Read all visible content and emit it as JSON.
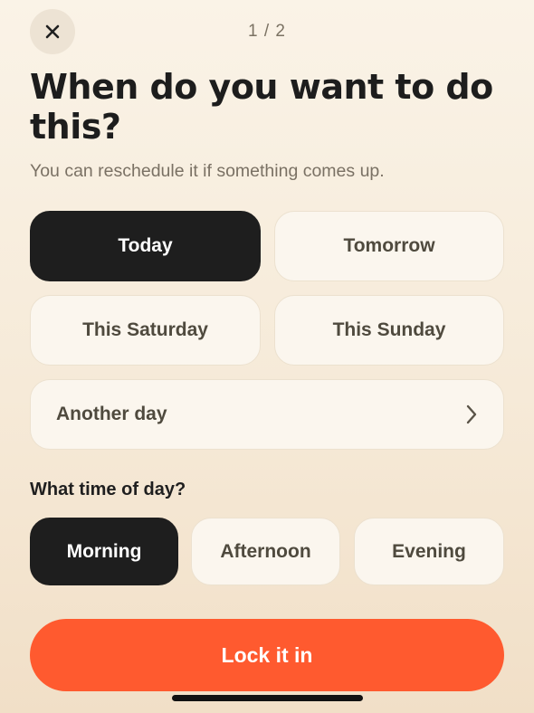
{
  "header": {
    "step": "1 / 2",
    "close_icon": "close-icon"
  },
  "title": "When do you want to do this?",
  "subtitle": "You can reschedule it if something comes up.",
  "day_options": {
    "today": "Today",
    "tomorrow": "Tomorrow",
    "saturday": "This Saturday",
    "sunday": "This Sunday",
    "another_day": "Another day",
    "another_day_icon": "chevron-right-icon",
    "selected": "Today"
  },
  "time_section": {
    "label": "What time of day?",
    "morning": "Morning",
    "afternoon": "Afternoon",
    "evening": "Evening",
    "selected": "Morning"
  },
  "cta": {
    "label": "Lock it in"
  },
  "colors": {
    "accent": "#ff5a2f",
    "selected": "#1e1e1e",
    "option_bg": "#fbf6ee",
    "background": "#f6ead8"
  }
}
